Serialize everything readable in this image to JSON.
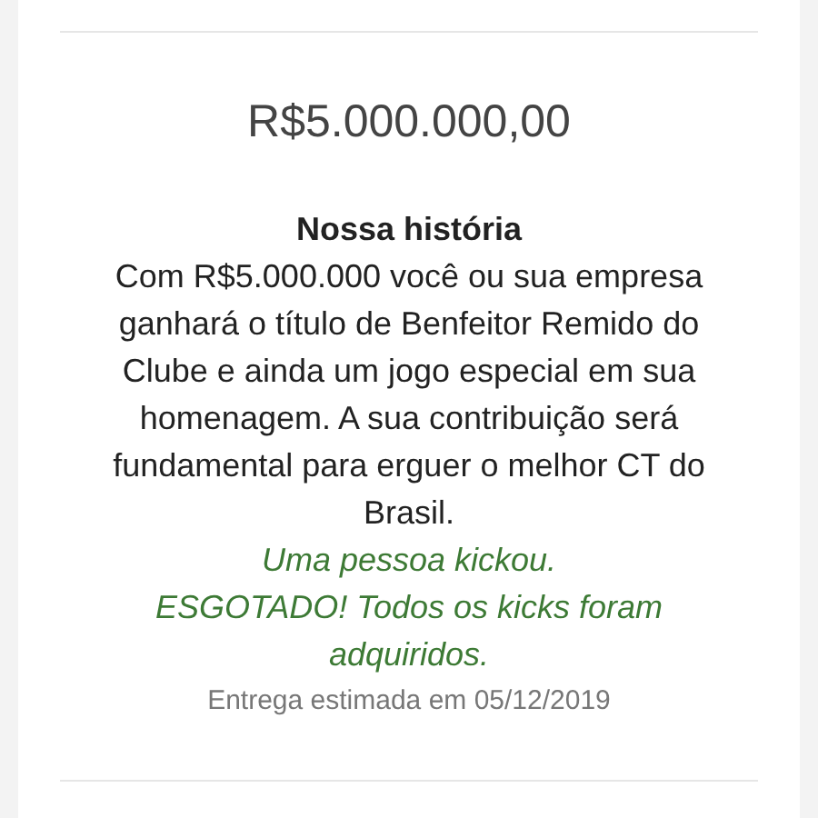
{
  "reward": {
    "price": "R$5.000.000,00",
    "title": "Nossa história",
    "description": "Com R$5.000.000 você ou sua empresa ganhará o título de Benfeitor Remido do Clube e ainda um jogo especial em sua homenagem. A sua contribuição será fundamental para erguer o melhor CT do Brasil.",
    "backers": "Uma pessoa kickou.",
    "sold_out": "ESGOTADO! Todos os kicks foram adquiridos.",
    "delivery": "Entrega estimada em 05/12/2019"
  }
}
